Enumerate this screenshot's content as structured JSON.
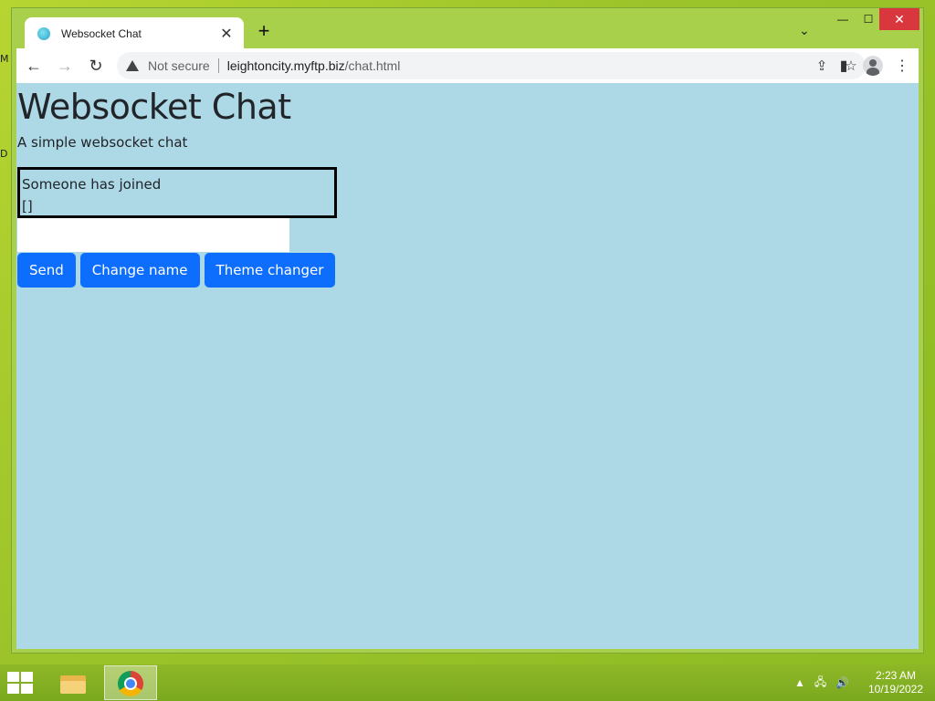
{
  "browser": {
    "tab_title": "Websocket Chat",
    "new_tab": "+",
    "security_label": "Not secure",
    "url_host": "leightoncity.myftp.biz",
    "url_path": "/chat.html"
  },
  "page": {
    "title": "Websocket Chat",
    "subtitle": "A simple websocket chat",
    "chat_messages": [
      "Someone has joined",
      "[]"
    ],
    "message_input_value": "",
    "buttons": {
      "send": "Send",
      "change_name": "Change name",
      "theme_changer": "Theme changer"
    },
    "background_color": "#add8e6",
    "button_color": "#0d6efd"
  },
  "taskbar": {
    "time": "2:23 AM",
    "date": "10/19/2022"
  },
  "desktop": {
    "edge_glyphs": [
      "M",
      "D"
    ]
  }
}
